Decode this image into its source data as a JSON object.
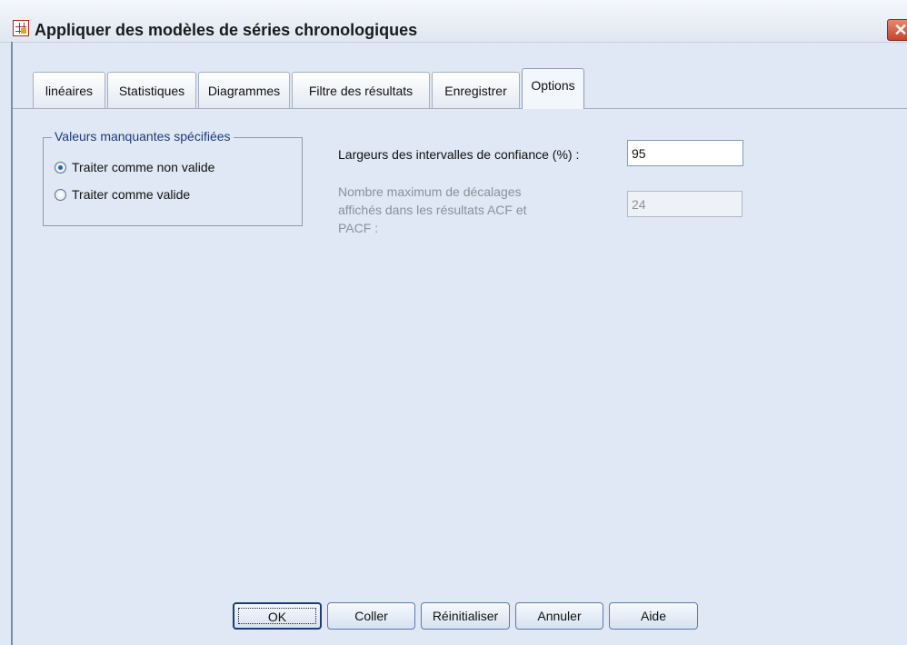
{
  "window": {
    "title": "Appliquer des modèles de séries chronologiques",
    "close_glyph": "✕"
  },
  "tabs": [
    {
      "label": "linéaires"
    },
    {
      "label": "Statistiques"
    },
    {
      "label": "Diagrammes"
    },
    {
      "label": "Filtre des résultats"
    },
    {
      "label": "Enregistrer"
    },
    {
      "label": "Options",
      "active": true
    }
  ],
  "missing_values": {
    "group_title": "Valeurs manquantes spécifiées",
    "options": [
      {
        "label": "Traiter comme non valide",
        "checked": true
      },
      {
        "label": "Traiter comme valide",
        "checked": false
      }
    ]
  },
  "confidence": {
    "label": "Largeurs des intervalles de confiance (%) :",
    "value": "95"
  },
  "max_lags": {
    "label_lines": [
      "Nombre maximum de décalages",
      "affichés dans les résultats ACF et",
      "PACF :"
    ],
    "value": "24",
    "enabled": false
  },
  "buttons": {
    "ok": "OK",
    "paste": "Coller",
    "reset": "Réinitialiser",
    "cancel": "Annuler",
    "help": "Aide"
  },
  "colors": {
    "background": "#dfe8f4",
    "group_title": "#1d3a7a",
    "radio_selected": "#1f63c6",
    "close": "#c9432b"
  }
}
